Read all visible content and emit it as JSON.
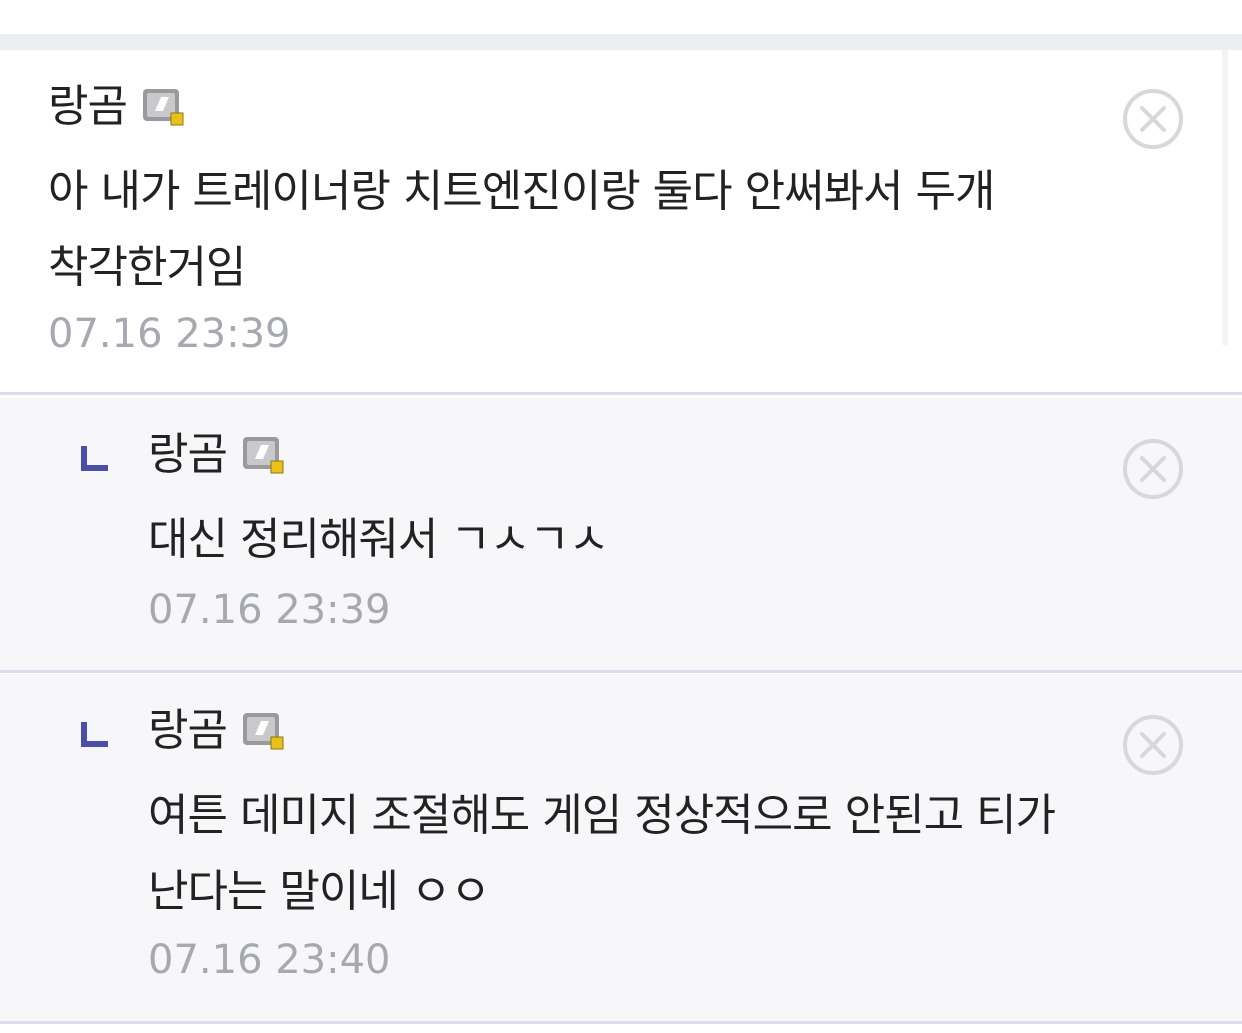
{
  "comments": [
    {
      "author": "랑곰",
      "badge_icon": "member-level-icon",
      "text": "아 내가 트레이너랑 치트엔진이랑 둘다 안써봐서 두개 착각한거임",
      "time": "07.16 23:39",
      "is_reply": false
    },
    {
      "author": "랑곰",
      "badge_icon": "member-level-icon",
      "text": "대신 정리해줘서 ㄱㅅㄱㅅ",
      "time": "07.16 23:39",
      "is_reply": true
    },
    {
      "author": "랑곰",
      "badge_icon": "member-level-icon",
      "text": "여튼 데미지 조절해도 게임 정상적으로 안된고 티가 난다는 말이네 ㅇㅇ",
      "time": "07.16 23:40",
      "is_reply": true
    }
  ],
  "colors": {
    "divider": "#dcdcea",
    "reply_background": "#f7f7fa",
    "reply_arrow": "#4b4fa8",
    "timestamp": "#a7a9b0",
    "delete_icon": "#d8d8dc",
    "badge_accent": "#e8c21a"
  },
  "icons": {
    "delete": "close-circle-icon",
    "reply": "reply-arrow-icon"
  }
}
